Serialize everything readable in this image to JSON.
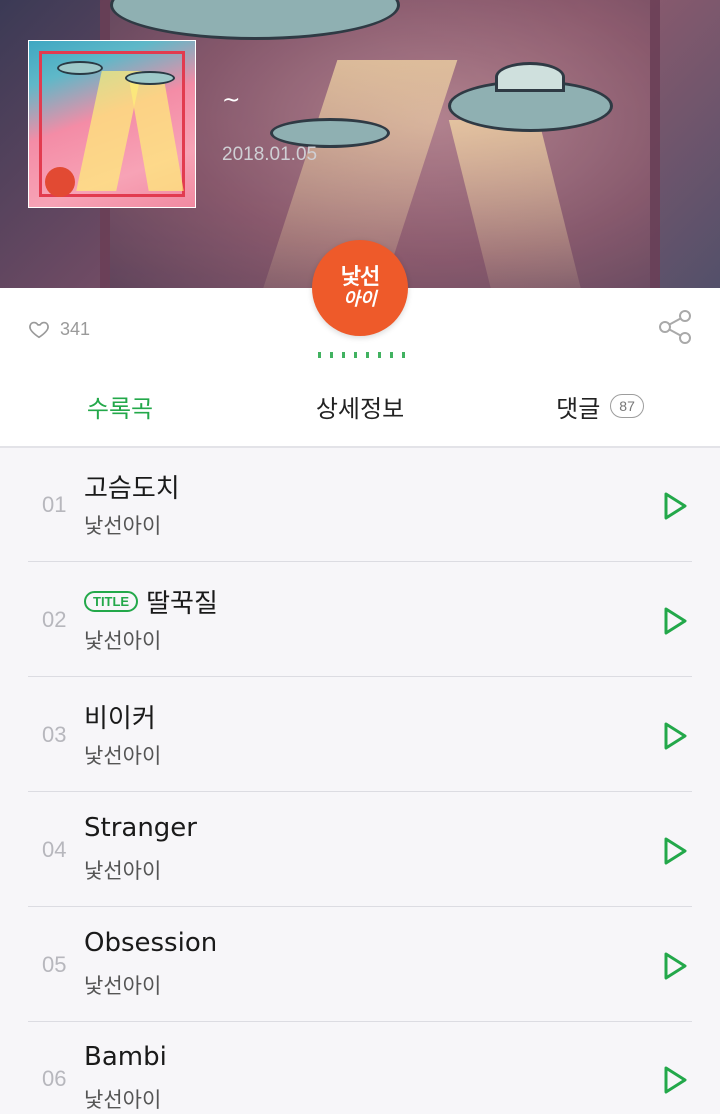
{
  "album": {
    "title": "~",
    "date": "2018.01.05"
  },
  "like": {
    "count": "341"
  },
  "artist_logo": {
    "line1": "낯선",
    "line2": "아이"
  },
  "tabs": [
    {
      "label": "수록곡",
      "active": true
    },
    {
      "label": "상세정보",
      "active": false
    },
    {
      "label": "댓글",
      "badge": "87",
      "active": false
    }
  ],
  "tracks": [
    {
      "num": "01",
      "title": "고슴도치",
      "artist": "낯선아이"
    },
    {
      "num": "02",
      "title": "딸꾹질",
      "artist": "낯선아이",
      "tag": "TITLE"
    },
    {
      "num": "03",
      "title": "비이커",
      "artist": "낯선아이"
    },
    {
      "num": "04",
      "title": "Stranger",
      "artist": "낯선아이"
    },
    {
      "num": "05",
      "title": "Obsession",
      "artist": "낯선아이"
    },
    {
      "num": "06",
      "title": "Bambi",
      "artist": "낯선아이"
    }
  ],
  "colors": {
    "accent": "#23a84a",
    "logo_bg": "#ee5a2a"
  },
  "icons": {
    "like": "heart-icon",
    "share": "share-icon",
    "play": "play-icon"
  }
}
